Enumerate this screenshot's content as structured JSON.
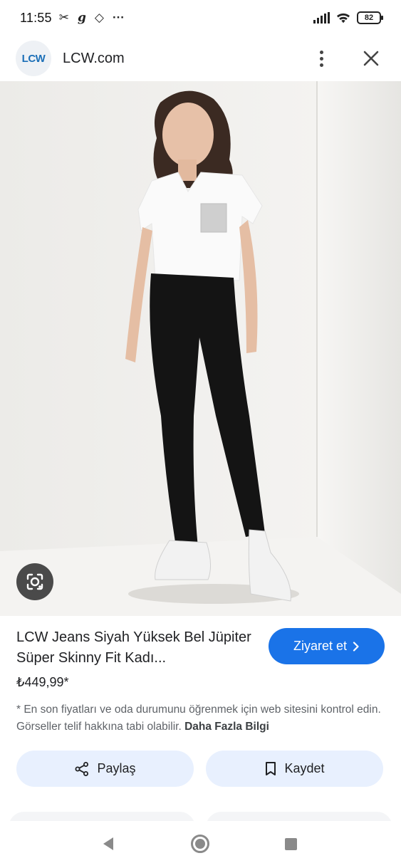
{
  "status_bar": {
    "time": "11:55",
    "battery_level": "82",
    "left_icons": [
      "cut-icon",
      "g-icon",
      "bookmark-icon",
      "more-dots-icon"
    ],
    "right_icons": [
      "signal-icon",
      "wifi-icon",
      "battery-icon"
    ]
  },
  "header": {
    "logo_text": "LCW",
    "site_name": "LCW.com"
  },
  "product": {
    "title": "LCW Jeans Siyah Yüksek Bel Jüpiter Süper Skinny Fit Kadı...",
    "price": "₺449,99*",
    "visit_label": "Ziyaret et",
    "disclaimer_text": "* En son fiyatları ve oda durumunu öğrenmek için web sitesini kontrol edin. Görseller telif hakkına tabi olabilir.",
    "more_info_label": "Daha Fazla Bilgi"
  },
  "actions": {
    "share_label": "Paylaş",
    "save_label": "Kaydet"
  },
  "colors": {
    "accent": "#1a73e8",
    "action_bg": "#e8f0fe",
    "logo_blue": "#1c6fb7"
  }
}
